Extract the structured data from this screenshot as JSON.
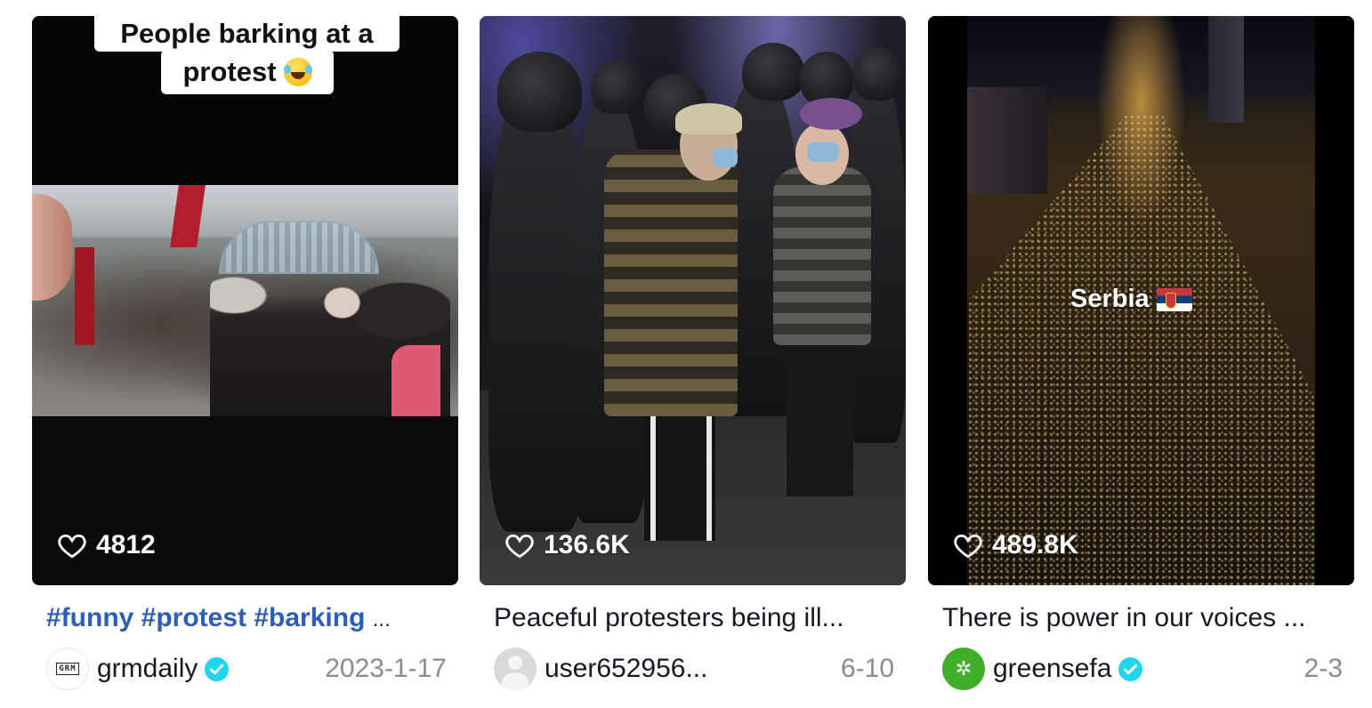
{
  "cards": [
    {
      "thumb_caption_line1": "People barking at a",
      "thumb_caption_line2": "protest",
      "likes": "4812",
      "description": "#funny #protest #barking",
      "ellipsis": "...",
      "username": "grmdaily",
      "avatar_text": "GRM",
      "verified": true,
      "date": "2023-1-17"
    },
    {
      "likes": "136.6K",
      "description": "Peaceful protesters being ill...",
      "username": "user652956...",
      "verified": false,
      "date": "6-10"
    },
    {
      "thumb_caption": "Serbia",
      "likes": "489.8K",
      "description": "There is power in our voices ...",
      "username": "greensefa",
      "avatar_icon": "green-cog-logo",
      "verified": true,
      "date": "2-3"
    }
  ],
  "colors": {
    "hashtag": "#2b5db9",
    "verified_badge": "#20d5ec",
    "muted_text": "#8a8b91"
  },
  "icons": {
    "like": "heart-outline-icon",
    "verified": "verified-badge-icon"
  }
}
